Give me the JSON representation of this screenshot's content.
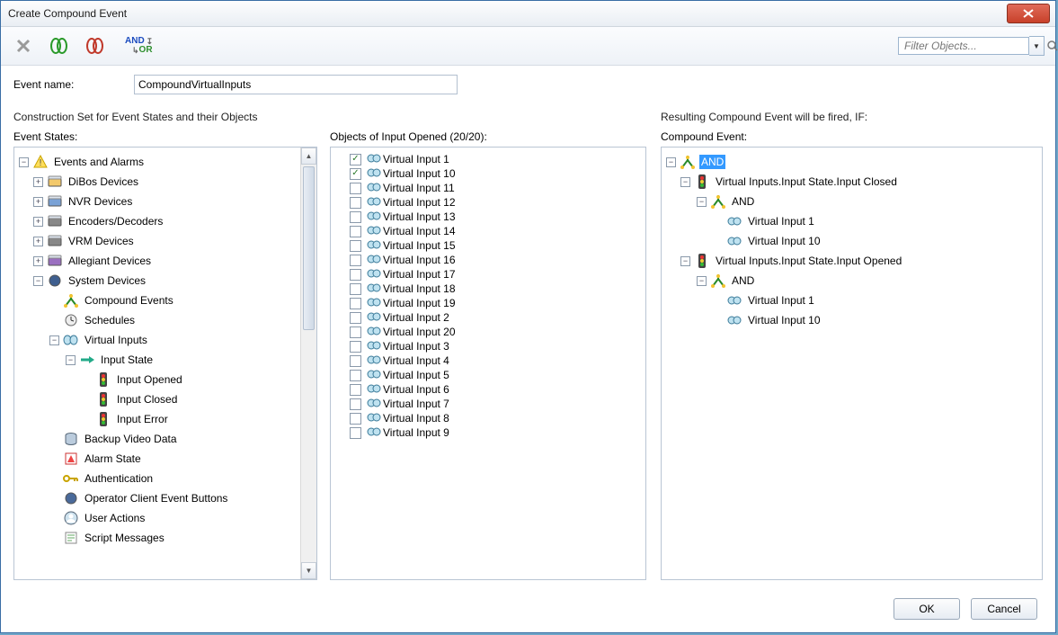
{
  "window": {
    "title": "Create Compound Event"
  },
  "toolbar": {
    "and_label": "AND",
    "or_label": "OR",
    "filter_placeholder": "Filter Objects..."
  },
  "form": {
    "event_name_label": "Event name:",
    "event_name_value": "CompoundVirtualInputs",
    "construction_set_label": "Construction Set for Event States and their Objects",
    "event_states_label": "Event States:",
    "objects_label": "Objects of Input Opened (20/20):",
    "resulting_label": "Resulting Compound Event will be fired, IF:",
    "compound_event_label": "Compound Event:"
  },
  "event_states_tree": {
    "root": "Events and Alarms",
    "items": [
      "DiBos Devices",
      "NVR Devices",
      "Encoders/Decoders",
      "VRM Devices",
      "Allegiant Devices"
    ],
    "system_devices": "System Devices",
    "system_children": [
      "Compound Events",
      "Schedules"
    ],
    "virtual_inputs": "Virtual Inputs",
    "input_state": "Input State",
    "input_state_children": [
      "Input Opened",
      "Input Closed",
      "Input Error"
    ],
    "system_tail": [
      "Backup Video Data",
      "Alarm State",
      "Authentication",
      "Operator Client Event Buttons",
      "User Actions",
      "Script Messages"
    ]
  },
  "objects_list": [
    {
      "label": "Virtual Input 1",
      "checked": true
    },
    {
      "label": "Virtual Input 10",
      "checked": true
    },
    {
      "label": "Virtual Input 11",
      "checked": false
    },
    {
      "label": "Virtual Input 12",
      "checked": false
    },
    {
      "label": "Virtual Input 13",
      "checked": false
    },
    {
      "label": "Virtual Input 14",
      "checked": false
    },
    {
      "label": "Virtual Input 15",
      "checked": false
    },
    {
      "label": "Virtual Input 16",
      "checked": false
    },
    {
      "label": "Virtual Input 17",
      "checked": false
    },
    {
      "label": "Virtual Input 18",
      "checked": false
    },
    {
      "label": "Virtual Input 19",
      "checked": false
    },
    {
      "label": "Virtual Input 2",
      "checked": false
    },
    {
      "label": "Virtual Input 20",
      "checked": false
    },
    {
      "label": "Virtual Input 3",
      "checked": false
    },
    {
      "label": "Virtual Input 4",
      "checked": false
    },
    {
      "label": "Virtual Input 5",
      "checked": false
    },
    {
      "label": "Virtual Input 6",
      "checked": false
    },
    {
      "label": "Virtual Input 7",
      "checked": false
    },
    {
      "label": "Virtual Input 8",
      "checked": false
    },
    {
      "label": "Virtual Input 9",
      "checked": false
    }
  ],
  "compound_event_tree": {
    "root_and": "AND",
    "closed_group": "Virtual Inputs.Input State.Input Closed",
    "closed_and": "AND",
    "closed_children": [
      "Virtual Input 1",
      "Virtual Input 10"
    ],
    "opened_group": "Virtual Inputs.Input State.Input Opened",
    "opened_and": "AND",
    "opened_children": [
      "Virtual Input 1",
      "Virtual Input 10"
    ]
  },
  "buttons": {
    "ok": "OK",
    "cancel": "Cancel"
  }
}
